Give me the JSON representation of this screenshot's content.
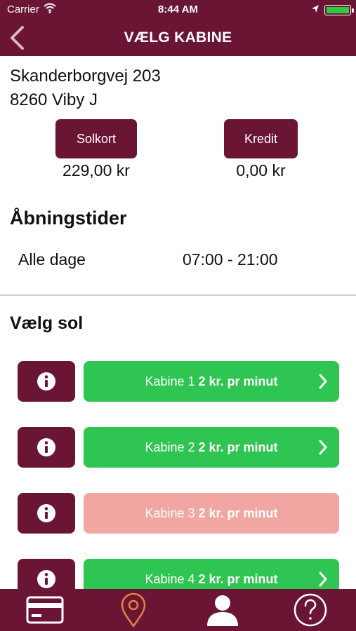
{
  "status": {
    "carrier": "Carrier",
    "time": "8:44 AM",
    "battery_level": 1.0
  },
  "nav": {
    "title": "VÆLG KABINE",
    "back_icon": "chevron-left-icon"
  },
  "location": {
    "street": "Skanderborgvej 203",
    "city": "8260 Viby J"
  },
  "balances": {
    "solkort_label": "Solkort",
    "solkort_amount": "229,00 kr",
    "kredit_label": "Kredit",
    "kredit_amount": "0,00 kr"
  },
  "hours": {
    "title": "Åbningstider",
    "days": "Alle dage",
    "time": "07:00 - 21:00"
  },
  "select": {
    "title": "Vælg sol"
  },
  "cabins": [
    {
      "name": "Kabine 1",
      "price": "2 kr. pr minut",
      "available": true
    },
    {
      "name": "Kabine 2",
      "price": "2 kr. pr minut",
      "available": true
    },
    {
      "name": "Kabine 3",
      "price": "2 kr. pr minut",
      "available": false
    },
    {
      "name": "Kabine 4",
      "price": "2 kr. pr minut",
      "available": true
    }
  ],
  "colors": {
    "brand": "#6b1535",
    "available": "#2fc552",
    "unavailable": "#f2a6a1",
    "active_tab": "#e2813f"
  },
  "tabbar": {
    "items": [
      {
        "icon": "credit-card-icon",
        "active": false
      },
      {
        "icon": "map-pin-icon",
        "active": true
      },
      {
        "icon": "user-icon",
        "active": false
      },
      {
        "icon": "help-icon",
        "active": false
      }
    ]
  }
}
